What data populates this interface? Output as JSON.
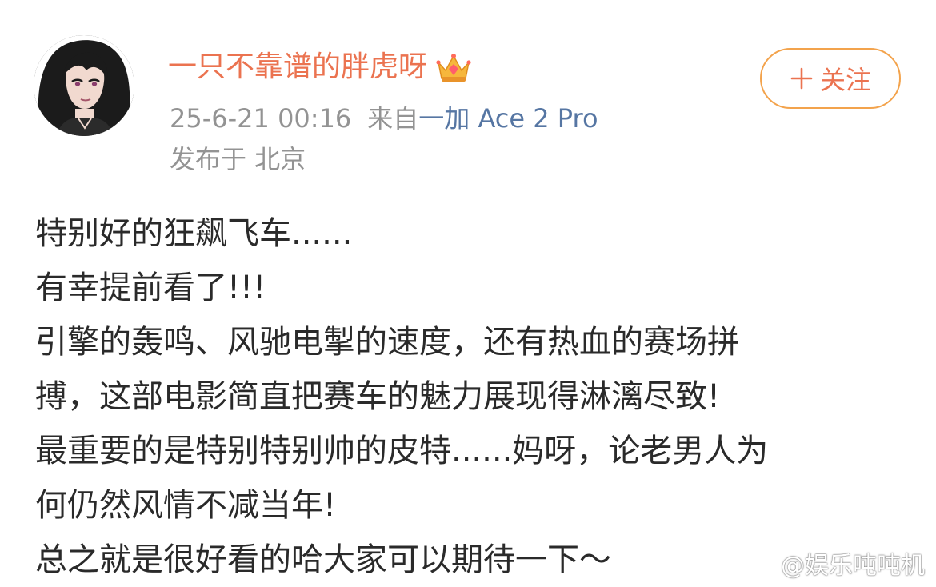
{
  "post": {
    "author": {
      "name": "一只不靠谱的胖虎呀",
      "avatar_icon": "avatar-illustration",
      "badge_icon": "crown-icon"
    },
    "timestamp": "25-6-21 00:16",
    "source_prefix": "来自",
    "device": "一加 Ace 2 Pro",
    "location": "发布于 北京",
    "follow_label": "关注",
    "content_lines": [
      "特别好的狂飙飞车......",
      "有幸提前看了!!!",
      "引擎的轰鸣、风驰电掣的速度，还有热血的赛场拼",
      "搏，这部电影简直把赛车的魅力展现得淋漓尽致!",
      "最重要的是特别特别帅的皮特......妈呀，论老男人为",
      "何仍然风情不减当年!",
      "总之就是很好看的哈大家可以期待一下～"
    ]
  },
  "watermark": {
    "icon": "weibo-logo-icon",
    "text": "@娱乐吨吨机"
  },
  "colors": {
    "username": "#eb7350",
    "meta": "#939393",
    "device_link": "#5676a3",
    "follow_border": "#f3a34c",
    "body_text": "#2a2a2a"
  }
}
